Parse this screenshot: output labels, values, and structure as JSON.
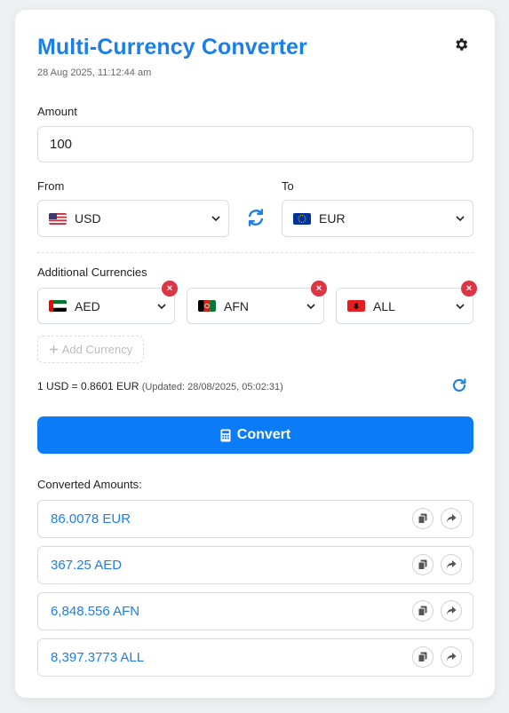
{
  "header": {
    "title": "Multi-Currency Converter",
    "timestamp": "28 Aug 2025, 11:12:44 am"
  },
  "amount": {
    "label": "Amount",
    "value": "100"
  },
  "from": {
    "label": "From",
    "code": "USD",
    "flag": "us-flag"
  },
  "to": {
    "label": "To",
    "code": "EUR",
    "flag": "eu-flag"
  },
  "additional": {
    "label": "Additional Currencies",
    "items": [
      {
        "code": "AED",
        "flag": "ae-flag"
      },
      {
        "code": "AFN",
        "flag": "af-flag"
      },
      {
        "code": "ALL",
        "flag": "al-flag"
      }
    ],
    "remove_glyph": "×",
    "add_label": "Add Currency"
  },
  "rate": {
    "text": "1 USD = 0.8601 EUR",
    "updated": "(Updated: 28/08/2025, 05:02:31)"
  },
  "convert_label": "Convert",
  "results": {
    "label": "Converted Amounts:",
    "items": [
      {
        "value": "86.0078 EUR"
      },
      {
        "value": "367.25 AED"
      },
      {
        "value": "6,848.556 AFN"
      },
      {
        "value": "8,397.3773 ALL"
      }
    ]
  },
  "colors": {
    "accent": "#1a7fe6",
    "button": "#0b7cf5",
    "remove": "#dc3545"
  },
  "icons": [
    "gear-icon",
    "swap-icon",
    "refresh-icon",
    "calculator-icon",
    "copy-icon",
    "share-icon",
    "chevron-down-icon",
    "plus-icon"
  ]
}
